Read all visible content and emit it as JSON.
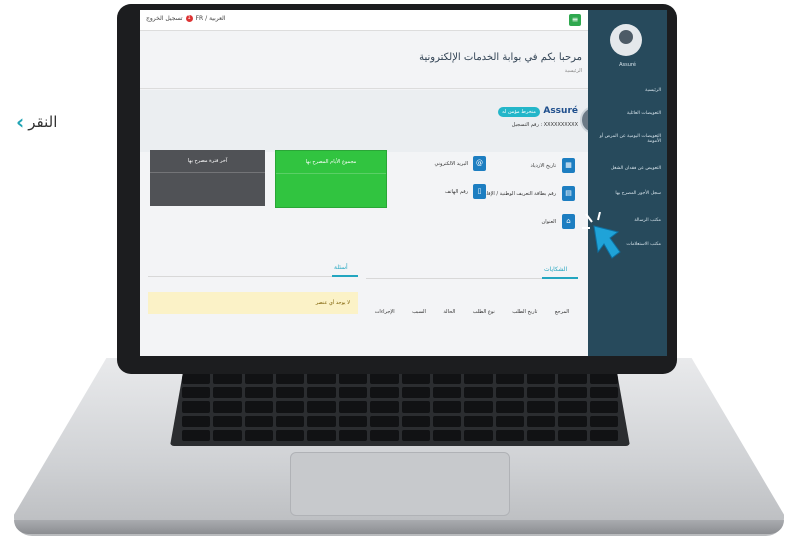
{
  "side_label": "النقر",
  "topbar": {
    "lang": "FR / العربية",
    "notif_count": "1",
    "user": "تسجيل الخروج",
    "menu_icon": "hamburger-icon"
  },
  "header": {
    "welcome": "مرحبا بكم في بوابة الخدمات الإلكترونية",
    "breadcrumb": "الرئيسية"
  },
  "profile": {
    "name": "Assuré",
    "status": "منخرط مؤمن له",
    "reg_label": "رقم التسجيل : XXXXXXXXXX"
  },
  "tiles": [
    {
      "label": "تاريخ الازدياد",
      "icon": "calendar-icon"
    },
    {
      "label": "البريد الالكتروني",
      "icon": "at-icon"
    },
    {
      "label": "رقم بطاقة التعريف الوطنية / الإقامة",
      "icon": "id-card-icon"
    },
    {
      "label": "رقم الهاتف",
      "icon": "phone-icon"
    },
    {
      "label": "العنوان",
      "icon": "home-icon"
    }
  ],
  "boxes": {
    "green_title": "مجموع الأيام المصرح بها",
    "dark_title": "آخر فترة مصرح بها"
  },
  "sections": {
    "left_title": "أسئلة",
    "right_title": "الشكايات"
  },
  "table": {
    "headers": [
      "المرجع",
      "تاريخ الطلب",
      "نوع الطلب",
      "الحالة",
      "السبب",
      "الإجراءات"
    ]
  },
  "warning": "لا يوجد أي عنصر",
  "sidebar": {
    "user": "Assuré",
    "items": [
      "الرئيسية",
      "التعويضات العائلية",
      "التعويضات اليومية عن المرض أو الأمومة",
      "التعويض عن فقدان الشغل",
      "سجل الأجور المصرح بها",
      "مكتب الرسالة",
      "مكتب الاستعلامات"
    ]
  }
}
